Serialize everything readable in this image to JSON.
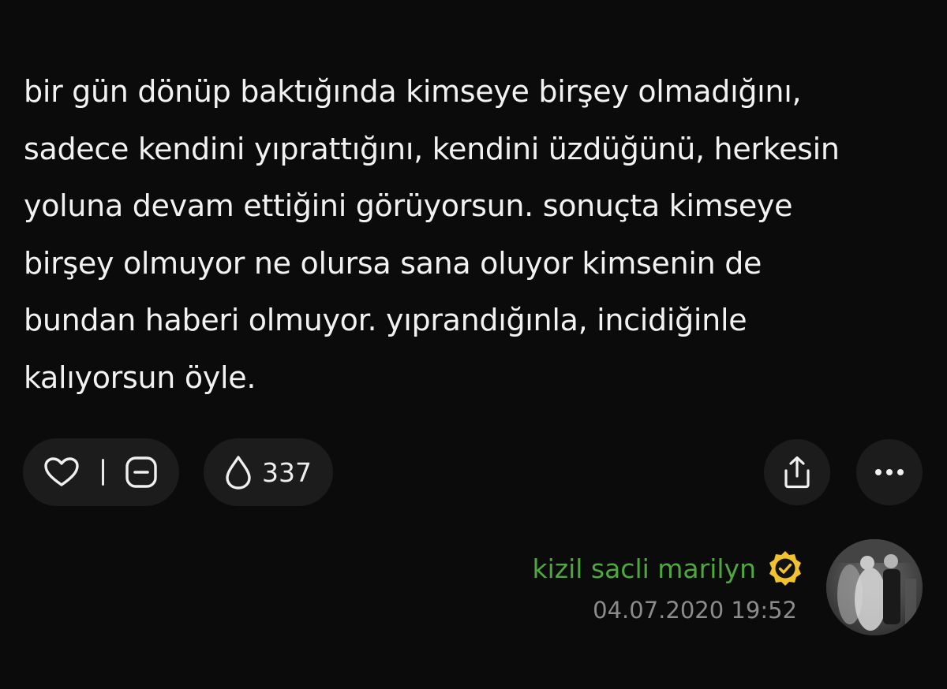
{
  "post": {
    "lines": [
      "bir gün dönüp baktığında kimseye birşey olmadığını,",
      "sadece kendini yıprattığını, kendini üzdüğünü, herkesin",
      "yoluna devam ettiğini görüyorsun. sonuçta kimseye",
      "birşey olmuyor ne olursa sana oluyor kimsenin de",
      "bundan haberi olmuyor. yıprandığınla, incidiğinle",
      "kalıyorsun öyle."
    ]
  },
  "actions": {
    "like_icon": "heart-icon",
    "dislike_icon": "minus-square-icon",
    "views_icon": "drop-icon",
    "views_count": "337",
    "share_icon": "share-icon",
    "more_icon": "more-horizontal-icon"
  },
  "author": {
    "name": "kizil sacli marilyn",
    "verified_icon": "verified-badge-icon",
    "timestamp": "04.07.2020 19:52",
    "name_color": "#4ea83e",
    "badge_color": "#f2c12e"
  },
  "theme": {
    "background": "#0b0b0b",
    "surface": "#1c1c1c",
    "text": "#f2f2f2",
    "muted": "#8c8c8c"
  }
}
